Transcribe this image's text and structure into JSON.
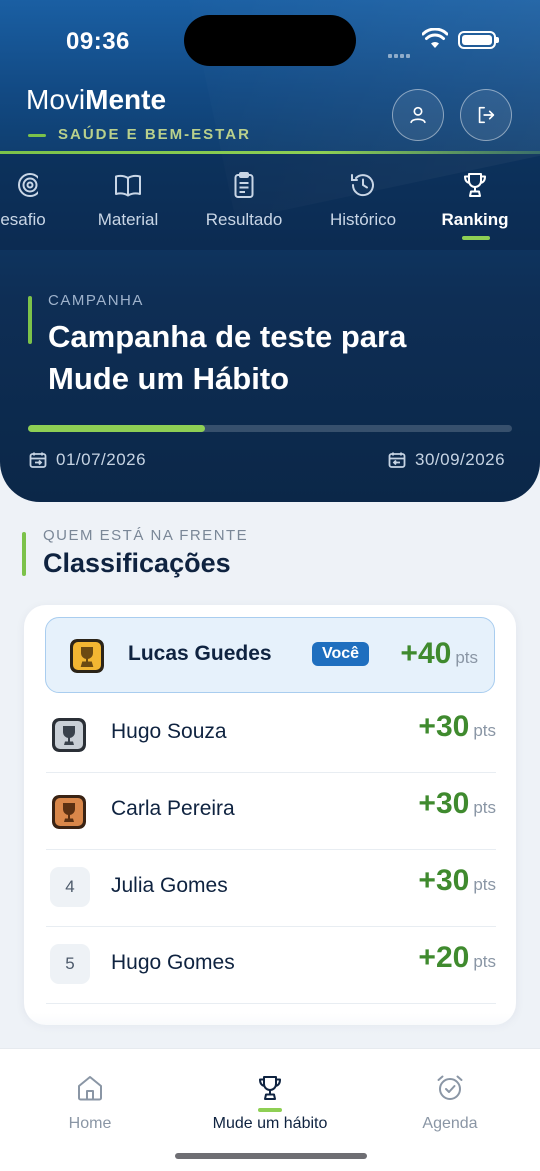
{
  "status_bar": {
    "time": "09:36"
  },
  "header": {
    "brand_light": "Movi",
    "brand_bold": "Mente",
    "tagline": "SAÚDE E BEM-ESTAR",
    "profile_icon": "user-icon",
    "logout_icon": "logout-icon"
  },
  "tabs": [
    {
      "label": "esafio",
      "icon": "target-icon"
    },
    {
      "label": "Material",
      "icon": "book-icon"
    },
    {
      "label": "Resultado",
      "icon": "clipboard-icon"
    },
    {
      "label": "Histórico",
      "icon": "history-icon"
    },
    {
      "label": "Ranking",
      "icon": "trophy-icon",
      "active": true
    }
  ],
  "campaign": {
    "label": "CAMPANHA",
    "title": "Campanha de teste para Mude um Hábito",
    "progress_fraction": 0.365,
    "start_date": "01/07/2026",
    "end_date": "30/09/2026"
  },
  "section": {
    "kicker": "QUEM ESTÁ NA FRENTE",
    "title": "Classificações"
  },
  "ranking": {
    "you_badge": "Você",
    "pts_unit": "pts",
    "rows": [
      {
        "rank": "1",
        "name": "Lucas Guedes",
        "points": "+40",
        "medal": "gold",
        "me": true
      },
      {
        "rank": "2",
        "name": "Hugo Souza",
        "points": "+30",
        "medal": "silver"
      },
      {
        "rank": "3",
        "name": "Carla Pereira",
        "points": "+30",
        "medal": "bronze"
      },
      {
        "rank": "4",
        "name": "Julia Gomes",
        "points": "+30"
      },
      {
        "rank": "5",
        "name": "Hugo Gomes",
        "points": "+20"
      }
    ]
  },
  "bottom_nav": [
    {
      "label": "Home",
      "icon": "home-icon"
    },
    {
      "label": "Mude um hábito",
      "icon": "trophy-icon",
      "active": true
    },
    {
      "label": "Agenda",
      "icon": "alarm-clock-icon"
    }
  ],
  "colors": {
    "accent_green": "#8ecf54",
    "primary_blue": "#1f6fbf",
    "points_green": "#3f8a2e",
    "header_navy": "#0b2748"
  }
}
